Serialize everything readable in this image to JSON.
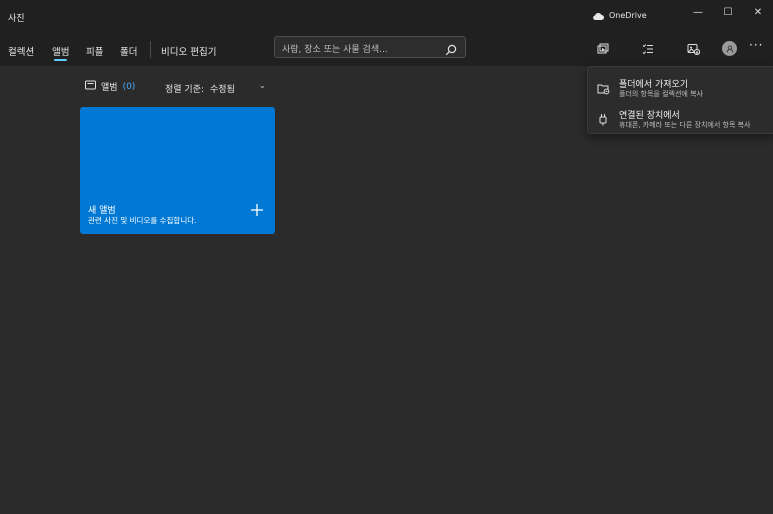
{
  "window": {
    "app_title": "사진",
    "onedrive_label": "OneDrive",
    "controls": {
      "minimize": "—",
      "maximize": "☐",
      "close": "✕"
    }
  },
  "nav": {
    "tabs": [
      {
        "label": "컬렉션",
        "active": false
      },
      {
        "label": "앨범",
        "active": true
      },
      {
        "label": "피플",
        "active": false
      },
      {
        "label": "폴더",
        "active": false
      }
    ],
    "video_editor_label": "비디오 편집기"
  },
  "search": {
    "placeholder": "사람, 장소 또는 사물 검색..."
  },
  "toolbar": {
    "icons": [
      "slideshow-icon",
      "select-icon",
      "import-icon"
    ],
    "more_label": "···"
  },
  "albums": {
    "label": "앨범",
    "count": "(0)",
    "sort_label": "정렬 기준:",
    "sort_value": "수정됨"
  },
  "new_album_card": {
    "title": "새 앨범",
    "subtitle": "관련 사진 및 비디오를 수집합니다."
  },
  "import_menu": {
    "items": [
      {
        "title": "폴더에서 가져오기",
        "subtitle": "폴더의 항목을 컬렉션에 복사"
      },
      {
        "title": "연결된 장치에서",
        "subtitle": "휴대폰, 카메라 또는 다른 장치에서 항목 복사"
      }
    ]
  },
  "colors": {
    "accent": "#0078d4",
    "tab_indicator": "#60cdff",
    "background": "#2b2b2b",
    "chrome": "#202020"
  }
}
